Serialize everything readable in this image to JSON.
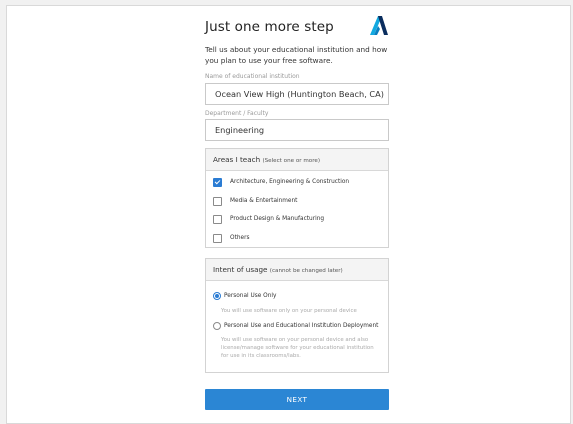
{
  "form": {
    "title": "Just one more step",
    "intro": "Tell us about your educational institution and how you plan to use your free software.",
    "institution_label": "Name of educational institution",
    "institution_value": "Ocean View High (Huntington Beach, CA)",
    "department_label": "Department / Faculty",
    "department_value": "Engineering",
    "areas": {
      "heading": "Areas I teach",
      "subheading": "(Select one or more)",
      "options": [
        {
          "label": "Architecture, Engineering & Construction",
          "checked": true
        },
        {
          "label": "Media & Entertainment",
          "checked": false
        },
        {
          "label": "Product Design & Manufacturing",
          "checked": false
        },
        {
          "label": "Others",
          "checked": false
        }
      ]
    },
    "intent": {
      "heading": "Intent of usage",
      "subheading": "(cannot be changed later)",
      "options": [
        {
          "label": "Personal Use Only",
          "description": "You will use software only on your personal device",
          "selected": true
        },
        {
          "label": "Personal Use and Educational Institution Deployment",
          "description": "You will use software on your personal device and also license/manage software for your educational institution for use in its classrooms/labs.",
          "selected": false
        }
      ]
    },
    "next_label": "NEXT"
  },
  "colors": {
    "accent": "#2b86d4",
    "logo_left": "#0a7ec0",
    "logo_right": "#0a2d5e",
    "logo_accent": "#12a9e0"
  },
  "icons": {
    "logo": "autodesk-logo-icon"
  }
}
